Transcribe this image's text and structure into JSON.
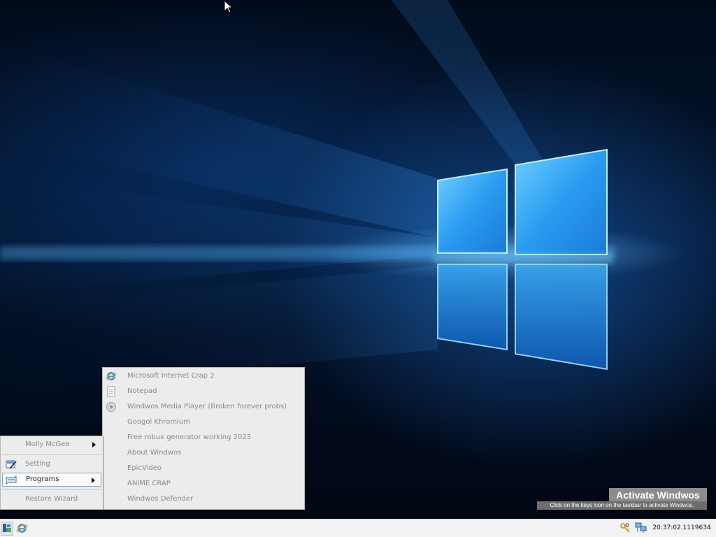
{
  "user_menu": {
    "user_name": "Molly McGee",
    "setting_label": "Setting",
    "programs_label": "Programs",
    "restore_label": "Restore Wizard"
  },
  "programs": [
    {
      "label": "Microsoft Internet Crap 2",
      "icon": "internet-explorer-icon"
    },
    {
      "label": "Notepad",
      "icon": "notepad-icon"
    },
    {
      "label": "Windwos Media Player (Broken forever probs)",
      "icon": "media-player-icon"
    },
    {
      "label": "Googol Khromium",
      "icon": ""
    },
    {
      "label": "Free robux generator working 2023",
      "icon": ""
    },
    {
      "label": "About Windwos",
      "icon": ""
    },
    {
      "label": "EpicVideo",
      "icon": ""
    },
    {
      "label": "ANIME CRAP",
      "icon": ""
    },
    {
      "label": "Windwos Defender",
      "icon": ""
    }
  ],
  "activation": {
    "title": "Activate Windwos",
    "message": "Click on the keys icon on the taskbar to activate Windwos."
  },
  "taskbar": {
    "clock": "20:37:02.1119634"
  },
  "colors": {
    "menu_background": "#ececec",
    "menu_text": "#8a8a8a",
    "highlight_border": "#7aa6d3",
    "taskbar": "#f2f2f2"
  }
}
